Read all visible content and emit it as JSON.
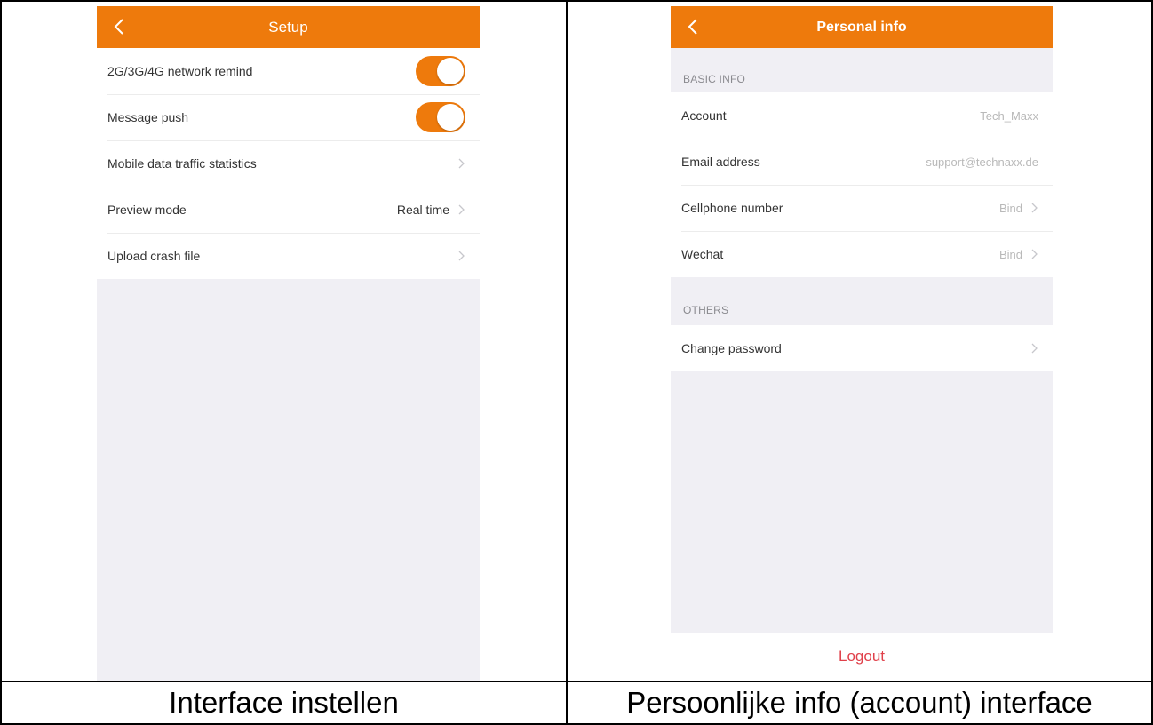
{
  "setup_screen": {
    "title": "Setup",
    "rows": [
      {
        "label": "2G/3G/4G network remind",
        "toggle": "on"
      },
      {
        "label": "Message push",
        "toggle": "on"
      },
      {
        "label": "Mobile data traffic statistics"
      },
      {
        "label": "Preview mode",
        "value": "Real time"
      },
      {
        "label": "Upload crash file"
      }
    ]
  },
  "personal_screen": {
    "title": "Personal info",
    "basic_header": "BASIC INFO",
    "basic_rows": [
      {
        "label": "Account",
        "value": "Tech_Maxx"
      },
      {
        "label": "Email address",
        "value": "support@technaxx.de"
      },
      {
        "label": "Cellphone number",
        "value": "Bind"
      },
      {
        "label": "Wechat",
        "value": "Bind"
      }
    ],
    "others_header": "OTHERS",
    "others_rows": [
      {
        "label": "Change password"
      }
    ],
    "logout_label": "Logout"
  },
  "captions": {
    "left": "Interface instellen",
    "right": "Persoonlijke info (account) interface"
  },
  "colors": {
    "accent": "#ee7a0c",
    "logout": "#e0404a",
    "background": "#f0eff4"
  }
}
